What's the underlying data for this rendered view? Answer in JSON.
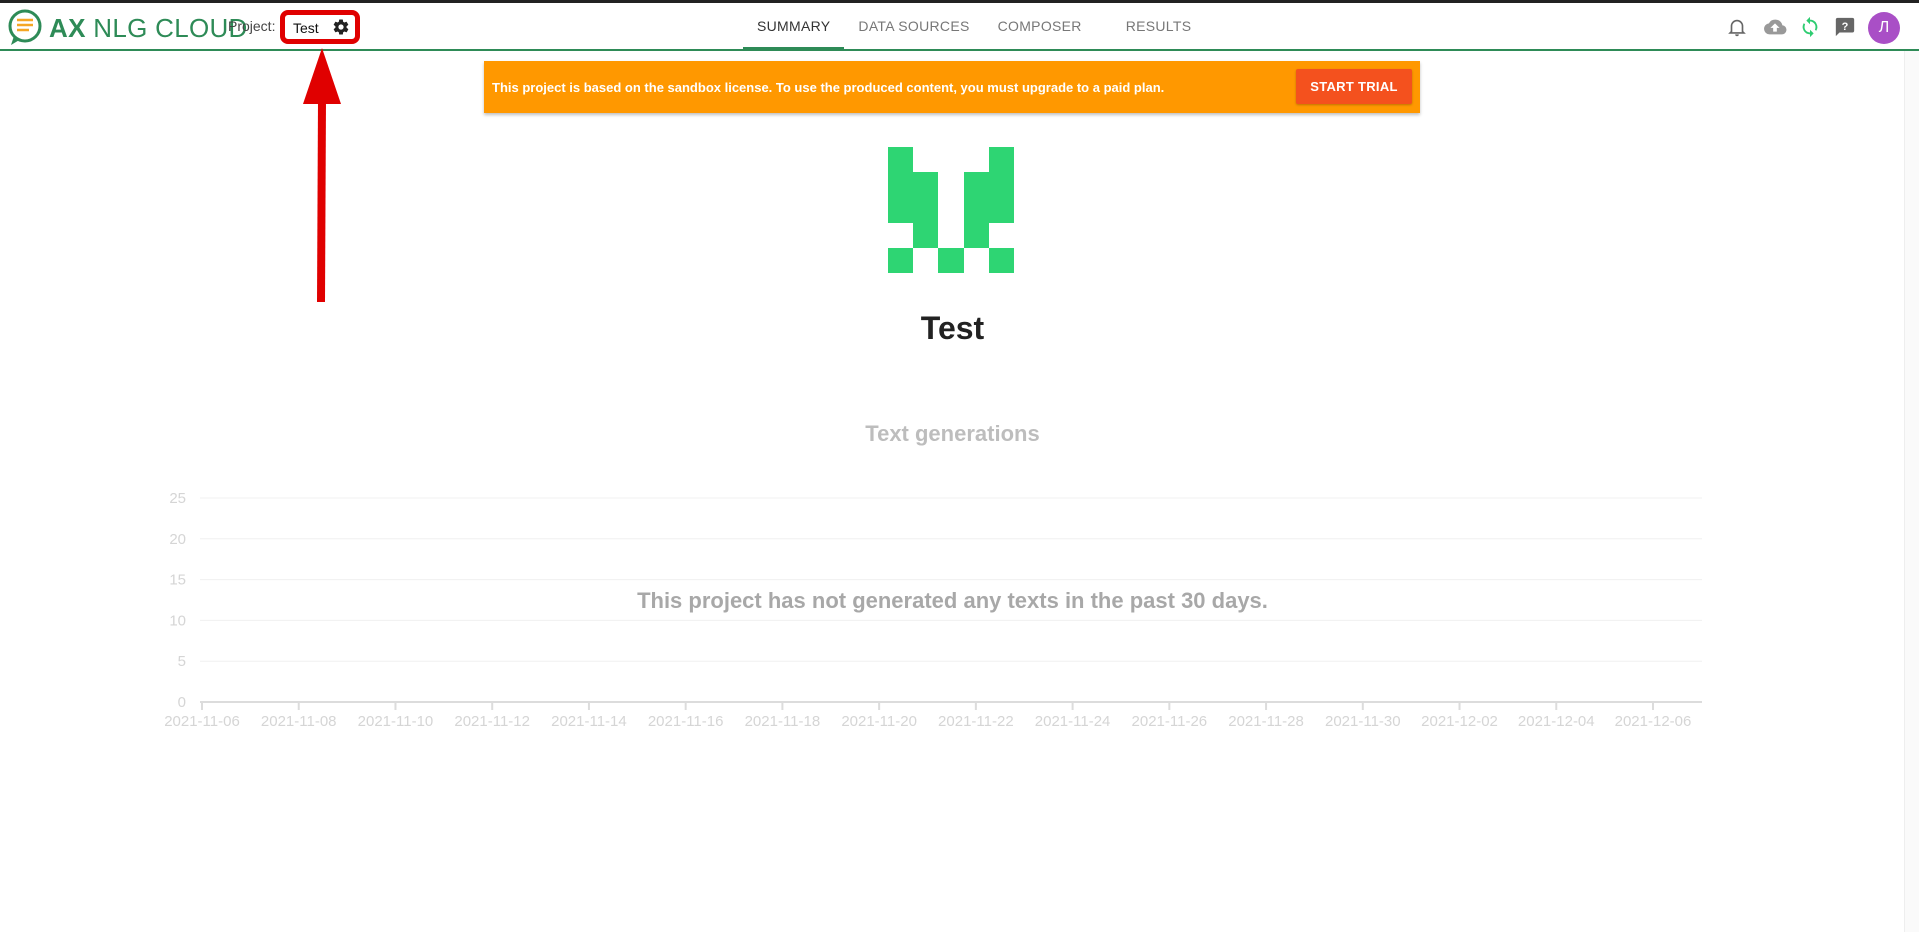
{
  "header": {
    "logo": {
      "bold": "AX",
      "rest": " NLG CLOUD"
    },
    "project_label": "Project:",
    "project_name": "Test",
    "tabs": [
      {
        "label": "SUMMARY",
        "active": true
      },
      {
        "label": "DATA SOURCES",
        "active": false
      },
      {
        "label": "COMPOSER",
        "active": false
      },
      {
        "label": "RESULTS",
        "active": false
      }
    ],
    "icons": [
      "bell-icon",
      "cloud-upload-icon",
      "sync-icon",
      "feedback-icon"
    ],
    "avatar_initial": "Л",
    "colors": {
      "brand_green": "#2e8b57",
      "avatar": "#a94fc6",
      "highlight_red": "#e00000"
    }
  },
  "banner": {
    "text": "This project is based on the sandbox license. To use the produced content, you must upgrade to a paid plan.",
    "button": "START TRIAL",
    "colors": {
      "background": "#ff9800",
      "button": "#f4511e"
    }
  },
  "project": {
    "title": "Test",
    "identicon_color": "#2ed573"
  },
  "chart_data": {
    "type": "line",
    "title": "Text generations",
    "empty_message": "This project has not generated any texts in the past 30 days.",
    "x_ticks": [
      "2021-11-06",
      "2021-11-08",
      "2021-11-10",
      "2021-11-12",
      "2021-11-14",
      "2021-11-16",
      "2021-11-18",
      "2021-11-20",
      "2021-11-22",
      "2021-11-24",
      "2021-11-26",
      "2021-11-28",
      "2021-11-30",
      "2021-12-02",
      "2021-12-04",
      "2021-12-06"
    ],
    "y_ticks": [
      "0",
      "5",
      "10",
      "15",
      "20",
      "25"
    ],
    "ylim": [
      0,
      25
    ],
    "series": [],
    "grid": true
  }
}
